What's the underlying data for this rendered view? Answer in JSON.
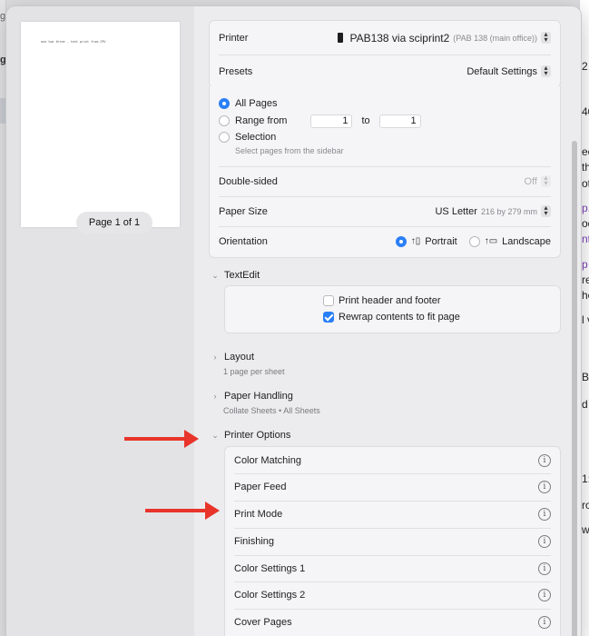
{
  "background": {
    "left_fragments": [
      "g",
      "g"
    ],
    "right_fragments": [
      "2 A",
      "40",
      "ee",
      "th",
      "ot",
      "p.",
      "od",
      "nte",
      "p",
      "re",
      "he",
      "l v",
      "B",
      "d",
      "1:1",
      "ro",
      "wa"
    ]
  },
  "preview": {
    "paper_text": "one two three - test print from CPU",
    "page_indicator": "Page 1 of 1"
  },
  "printer_card": {
    "printer_label": "Printer",
    "printer_value": "PAB138 via sciprint2",
    "printer_detail": "(PAB 138 (main office))",
    "presets_label": "Presets",
    "presets_value": "Default Settings"
  },
  "pages": {
    "all_pages": "All Pages",
    "range_from": "Range from",
    "range_start": "1",
    "range_to": "to",
    "range_end": "1",
    "selection": "Selection",
    "selection_hint": "Select pages from the sidebar",
    "selected": "All Pages"
  },
  "options": {
    "double_sided_label": "Double-sided",
    "double_sided_value": "Off",
    "paper_size_label": "Paper Size",
    "paper_size_value": "US Letter",
    "paper_size_detail": "216 by 279 mm",
    "orientation_label": "Orientation",
    "portrait": "Portrait",
    "landscape": "Landscape",
    "orientation_selected": "Portrait"
  },
  "textedit": {
    "title": "TextEdit",
    "header_footer": "Print header and footer",
    "header_footer_checked": false,
    "rewrap": "Rewrap contents to fit page",
    "rewrap_checked": true
  },
  "layout": {
    "title": "Layout",
    "summary": "1 page per sheet"
  },
  "paper_handling": {
    "title": "Paper Handling",
    "summary": "Collate Sheets • All Sheets"
  },
  "printer_options": {
    "title": "Printer Options",
    "items": [
      "Color Matching",
      "Paper Feed",
      "Print Mode",
      "Finishing",
      "Color Settings 1",
      "Color Settings 2",
      "Cover Pages"
    ]
  },
  "icons": {
    "info": "info-icon",
    "chevron": "chevron-icon",
    "stepper": "stepper-icon",
    "arrow": "red-arrow-annotation"
  },
  "colors": {
    "accent": "#2a7ff6",
    "annotation_arrow": "#e8342a"
  }
}
